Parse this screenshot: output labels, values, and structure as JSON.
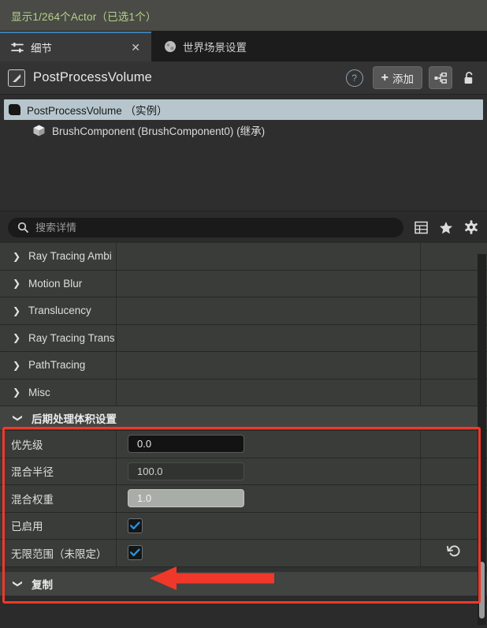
{
  "statusbar": {
    "text": "显示1/264个Actor（已选1个）",
    "color": "#b2d38a"
  },
  "tabs": [
    {
      "label": "细节",
      "icon": "sliders-icon",
      "active": true,
      "close_label": "✕"
    },
    {
      "label": "世界场景设置",
      "icon": "globe-icon",
      "active": false
    }
  ],
  "detail_header": {
    "object_icon": "volume-icon",
    "object_name": "PostProcessVolume",
    "help_label": "?",
    "add_label": "添加",
    "add_plus": "+",
    "blueprint_icon": "blueprint-icon",
    "lock_icon": "unlocked-padlock-icon"
  },
  "tree": {
    "rows": [
      {
        "label": "PostProcessVolume （实例）",
        "icon": "volume-blob-icon",
        "selected": true,
        "child": false
      },
      {
        "label": "BrushComponent (BrushComponent0) (继承)",
        "icon": "cube-icon",
        "selected": false,
        "child": true
      }
    ]
  },
  "search": {
    "placeholder": "搜索详情",
    "value": "",
    "icon": "search-icon",
    "tools": [
      {
        "name": "grid-view-icon",
        "glyph": "grid"
      },
      {
        "name": "favorites-star-icon",
        "glyph": "star"
      },
      {
        "name": "settings-gear-icon",
        "glyph": "gear"
      }
    ]
  },
  "categories": [
    {
      "label": "Ray Tracing Ambi",
      "expanded": false
    },
    {
      "label": "Motion Blur",
      "expanded": false
    },
    {
      "label": "Translucency",
      "expanded": false
    },
    {
      "label": "Ray Tracing Trans",
      "expanded": false
    },
    {
      "label": "PathTracing",
      "expanded": false
    },
    {
      "label": "Misc",
      "expanded": false
    }
  ],
  "highlighted_section": {
    "header": "后期处理体积设置",
    "expanded": true,
    "rows": [
      {
        "label": "优先级",
        "type": "number",
        "value": "0.0",
        "style": "dark",
        "reset": false
      },
      {
        "label": "混合半径",
        "type": "number",
        "value": "100.0",
        "style": "mid",
        "reset": false
      },
      {
        "label": "混合权重",
        "type": "number",
        "value": "1.0",
        "style": "light",
        "reset": false
      },
      {
        "label": "已启用",
        "type": "checkbox",
        "checked": true,
        "reset": false
      },
      {
        "label": "无限范围（未限定）",
        "type": "checkbox",
        "checked": true,
        "reset": true,
        "reset_icon": "reset-arrow-icon"
      }
    ]
  },
  "bottom_section": {
    "label": "复制",
    "expanded": true
  },
  "annotation": {
    "box_color": "#f0382a",
    "arrow_color": "#f0382a",
    "arrow_name": "red-pointer-arrow"
  },
  "scrollbar": {
    "name": "vertical-scrollbar",
    "thumb_name": "scrollbar-thumb"
  }
}
